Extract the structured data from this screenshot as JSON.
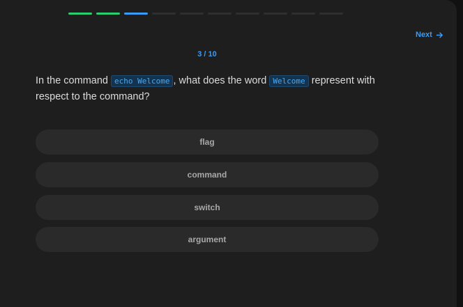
{
  "progress": {
    "current": 3,
    "total": 10,
    "counter_text": "3 / 10",
    "done_color": "#2ecc71",
    "current_color": "#3b9cf5",
    "pending_color": "#2f2f2f"
  },
  "nav": {
    "next_label": "Next",
    "next_icon": "arrow-right-icon"
  },
  "question": {
    "part1": "In the command ",
    "code1": "echo Welcome",
    "part2": ", what does the word ",
    "code2": "Welcome",
    "part3": " represent with respect to the command?"
  },
  "options": [
    {
      "label": "flag"
    },
    {
      "label": "command"
    },
    {
      "label": "switch"
    },
    {
      "label": "argument"
    }
  ]
}
